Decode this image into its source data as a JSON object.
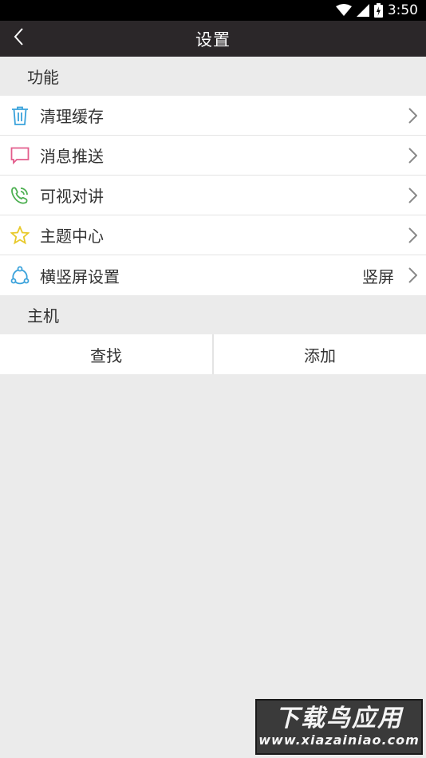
{
  "status_bar": {
    "time": "3:50",
    "icons": [
      "wifi-icon",
      "signal-icon",
      "battery-icon"
    ]
  },
  "app_bar": {
    "title": "设置",
    "back_icon": "chevron-left-icon"
  },
  "sections": {
    "features": {
      "header": "功能",
      "items": [
        {
          "label": "清理缓存",
          "icon": "trash-icon",
          "color": "#3aa2db"
        },
        {
          "label": "消息推送",
          "icon": "message-icon",
          "color": "#e35d8c"
        },
        {
          "label": "可视对讲",
          "icon": "phone-icon",
          "color": "#4caf50"
        },
        {
          "label": "主题中心",
          "icon": "star-icon",
          "color": "#e8c92a"
        },
        {
          "label": "横竖屏设置",
          "icon": "rotate-icon",
          "color": "#3aa2db",
          "value": "竖屏"
        }
      ]
    },
    "host": {
      "header": "主机",
      "buttons": {
        "find": "查找",
        "add": "添加"
      }
    }
  },
  "watermark": {
    "title": "下载鸟应用",
    "url": "www.xiazainiao.com"
  },
  "colors": {
    "appbar": "#2b2729",
    "background": "#ebebeb",
    "chevron": "#888888"
  }
}
